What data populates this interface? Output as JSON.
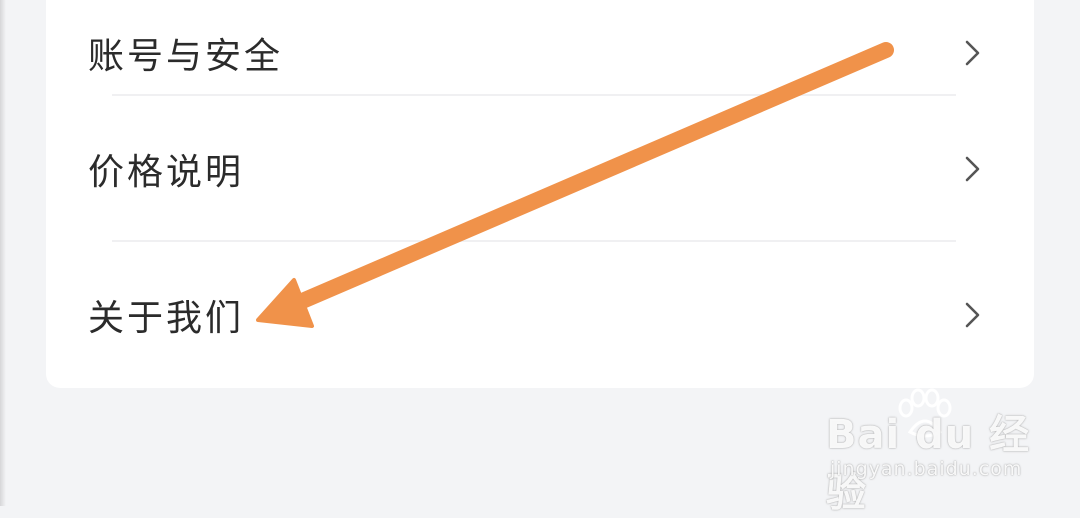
{
  "settings": {
    "items": [
      {
        "label": "账号与安全",
        "icon": "chevron-right-icon"
      },
      {
        "label": "价格说明",
        "icon": "chevron-right-icon"
      },
      {
        "label": "关于我们",
        "icon": "chevron-right-icon"
      }
    ]
  },
  "annotation": {
    "arrow_color": "#f0924a",
    "icon": "arrow-annotation-icon"
  },
  "watermark": {
    "logo": "Bai du 经验",
    "url": "jingyan.baidu.com"
  },
  "colors": {
    "background": "#f3f4f6",
    "card": "#ffffff",
    "text": "#2b2b2b",
    "chevron": "#555555"
  }
}
